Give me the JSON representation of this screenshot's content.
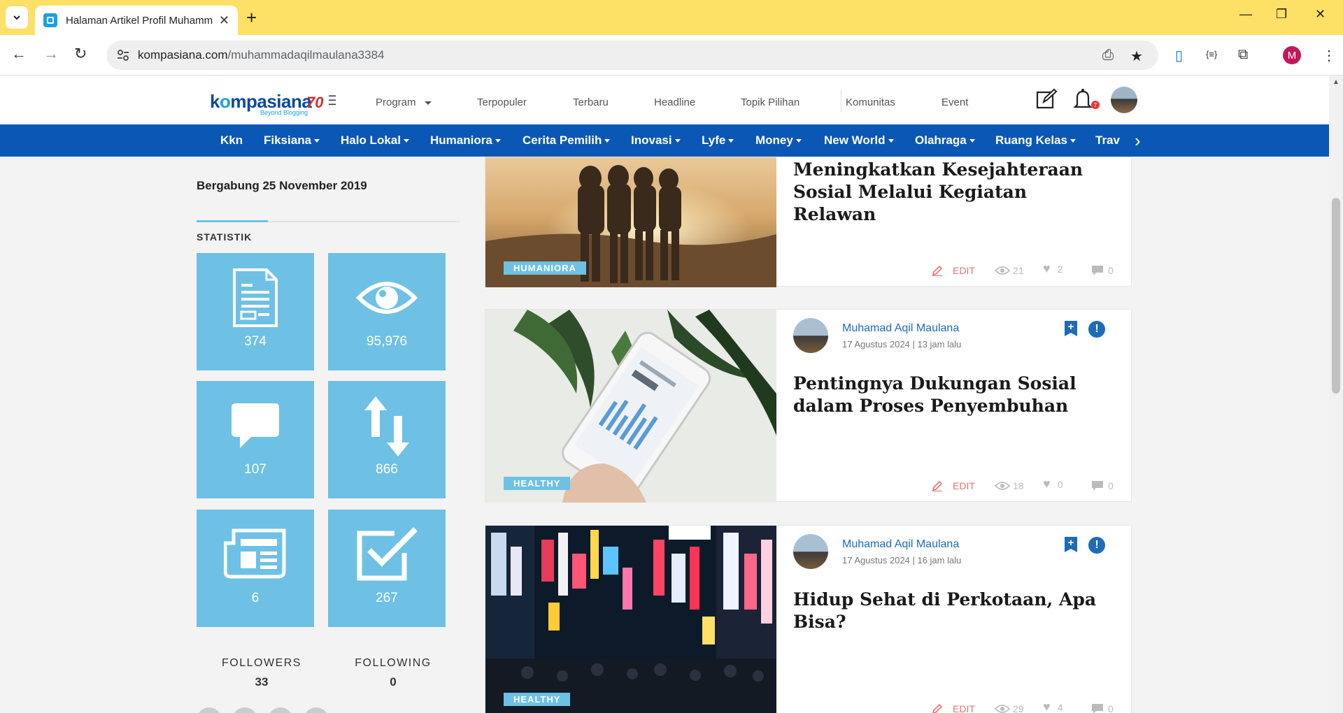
{
  "browser": {
    "tab_title": "Halaman Artikel Profil Muhamma",
    "url_domain": "kompasiana.com",
    "url_path": "/muhammadaqilmaulana3384",
    "profile_initial": "M"
  },
  "header": {
    "logo": {
      "pre": "k",
      "o": "o",
      "post": "mpasiana",
      "sub": "Beyond Blogging",
      "num": "70"
    },
    "nav": [
      "Program",
      "Terpopuler",
      "Terbaru",
      "Headline",
      "Topik Pilihan",
      "Komunitas",
      "Event"
    ],
    "notif_count": "7"
  },
  "categories": [
    "Kkn",
    "Fiksiana",
    "Halo Lokal",
    "Humaniora",
    "Cerita Pemilih",
    "Inovasi",
    "Lyfe",
    "Money",
    "New World",
    "Olahraga",
    "Ruang Kelas",
    "Trav"
  ],
  "sidebar": {
    "joined": "Bergabung 25 November 2019",
    "stat_heading": "STATISTIK",
    "stats": [
      {
        "icon": "document-icon",
        "value": "374"
      },
      {
        "icon": "eye-icon",
        "value": "95,976"
      },
      {
        "icon": "comment-icon",
        "value": "107"
      },
      {
        "icon": "transfer-arrows-icon",
        "value": "866"
      },
      {
        "icon": "newspaper-icon",
        "value": "6"
      },
      {
        "icon": "checkbox-icon",
        "value": "267"
      }
    ],
    "followers_label": "FOLLOWERS",
    "followers": "33",
    "following_label": "FOLLOWING",
    "following": "0"
  },
  "articles": [
    {
      "title": "Meningkatkan Kesejahteraan Sosial Melalui Kegiatan Relawan",
      "category": "HUMANIORA",
      "edit": "EDIT",
      "views": "21",
      "likes": "2",
      "comments": "0"
    },
    {
      "author": "Muhamad Aqil Maulana",
      "date": "17 Agustus 2024 | 13 jam lalu",
      "title": "Pentingnya Dukungan Sosial dalam Proses Penyembuhan",
      "category": "HEALTHY",
      "edit": "EDIT",
      "views": "18",
      "likes": "0",
      "comments": "0"
    },
    {
      "author": "Muhamad Aqil Maulana",
      "date": "17 Agustus 2024 | 16 jam lalu",
      "title": "Hidup Sehat di Perkotaan, Apa Bisa?",
      "category": "HEALTHY",
      "edit": "EDIT",
      "views": "29",
      "likes": "4",
      "comments": "0"
    }
  ],
  "colors": {
    "accent_blue": "#0b57b5",
    "tile_blue": "#6ec1e4",
    "edit_red": "#e57373",
    "tabstrip_yellow": "#fde066"
  }
}
